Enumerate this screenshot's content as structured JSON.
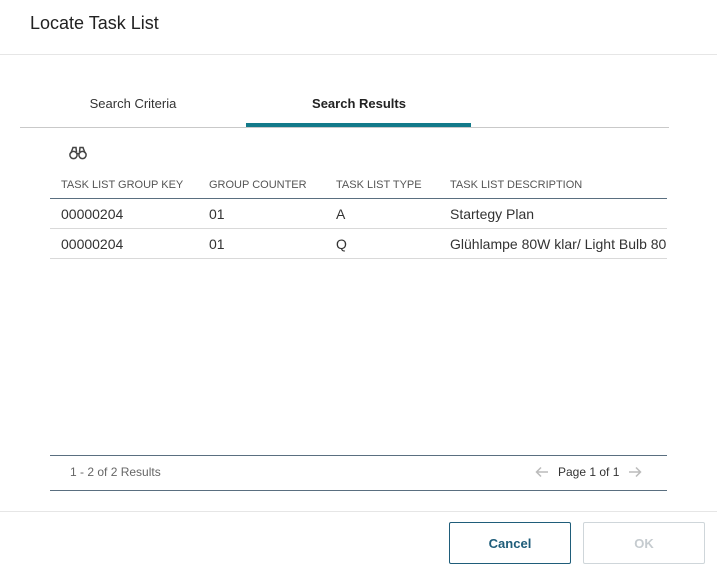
{
  "dialog": {
    "title": "Locate Task List"
  },
  "tabs": [
    {
      "label": "Search Criteria",
      "active": false
    },
    {
      "label": "Search Results",
      "active": true
    }
  ],
  "toolbar": {
    "icon": "binoculars-icon"
  },
  "grid": {
    "columns": [
      "TASK LIST GROUP KEY",
      "GROUP COUNTER",
      "TASK LIST TYPE",
      "TASK LIST DESCRIPTION"
    ],
    "rows": [
      [
        "00000204",
        "01",
        "A",
        "Startegy Plan"
      ],
      [
        "00000204",
        "01",
        "Q",
        "Glühlampe 80W klar/ Light Bulb 80"
      ]
    ]
  },
  "pager": {
    "results": "1 - 2 of 2 Results",
    "page": "Page 1 of 1",
    "prev_icon": "arrow-left-icon",
    "next_icon": "arrow-right-icon"
  },
  "footer": {
    "cancel_label": "Cancel",
    "ok_label": "OK"
  },
  "colors": {
    "accent": "#127a8a",
    "primary_button": "#1f5d7a",
    "disabled": "#c5cbcf"
  }
}
